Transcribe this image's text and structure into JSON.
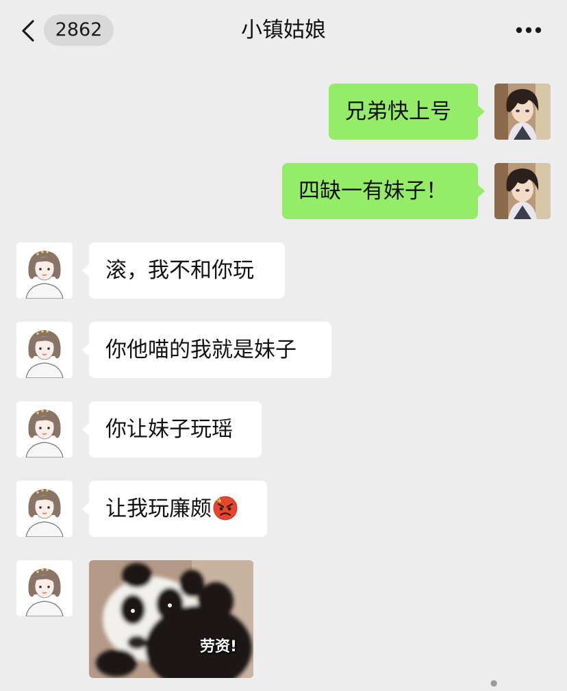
{
  "header": {
    "unread_count": "2862",
    "title": "小镇姑娘"
  },
  "messages": [
    {
      "side": "sent",
      "text": "兄弟快上号"
    },
    {
      "side": "sent",
      "text": "四缺一有妹子！"
    },
    {
      "side": "received",
      "text": "滚，我不和你玩"
    },
    {
      "side": "received",
      "text": "你他喵的我就是妹子"
    },
    {
      "side": "received",
      "text": "你让妹子玩瑶"
    },
    {
      "side": "received",
      "text": "让我玩廉颇",
      "emoji": "angry-face-emoji"
    },
    {
      "side": "received",
      "type": "sticker",
      "sticker": "panda-sticker",
      "caption": "劳资!"
    }
  ],
  "colors": {
    "background": "#ededed",
    "sent_bubble": "#95ec69",
    "received_bubble": "#ffffff",
    "badge": "#d9d9d9"
  },
  "icons": {
    "back": "chevron-left-icon",
    "more": "more-dots-icon"
  }
}
